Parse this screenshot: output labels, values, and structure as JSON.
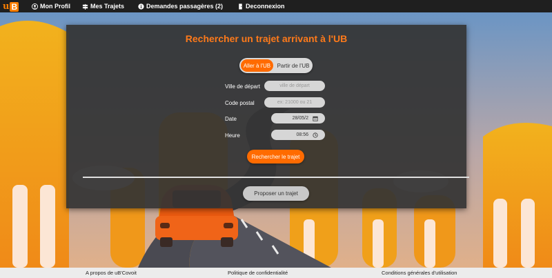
{
  "nav": {
    "logo_letters": "u",
    "logo_box": "B",
    "items": [
      {
        "label": "Mon Profil",
        "icon": "user-circle-icon"
      },
      {
        "label": "Mes Trajets",
        "icon": "signpost-icon"
      },
      {
        "label": "Demandes passagères (2)",
        "icon": "info-circle-icon"
      },
      {
        "label": "Deconnexion",
        "icon": "door-icon"
      }
    ]
  },
  "form": {
    "title": "Rechercher un trajet arrivant à l'UB",
    "toggle": {
      "option_a": "Aller à l'UB",
      "option_b": "Partir de l'UB",
      "selected": "option_a"
    },
    "fields": {
      "departure": {
        "label": "Ville de départ",
        "placeholder": "ville de départ"
      },
      "postal": {
        "label": "Code postal",
        "placeholder": "ex: 21000 ou 21"
      },
      "date": {
        "label": "Date",
        "value": "28/05/2"
      },
      "time": {
        "label": "Heure",
        "value": "08:56"
      }
    },
    "search_button": "Rechercher le trajet",
    "propose_button": "Proposer un trajet"
  },
  "footer": {
    "about": "A propos de uB'Covoit",
    "privacy": "Politique de confidentialité",
    "terms": "Conditions générales d'utilisation"
  },
  "colors": {
    "accent": "#ff6b00",
    "panel": "#343434",
    "nav": "#1f1f1f"
  }
}
